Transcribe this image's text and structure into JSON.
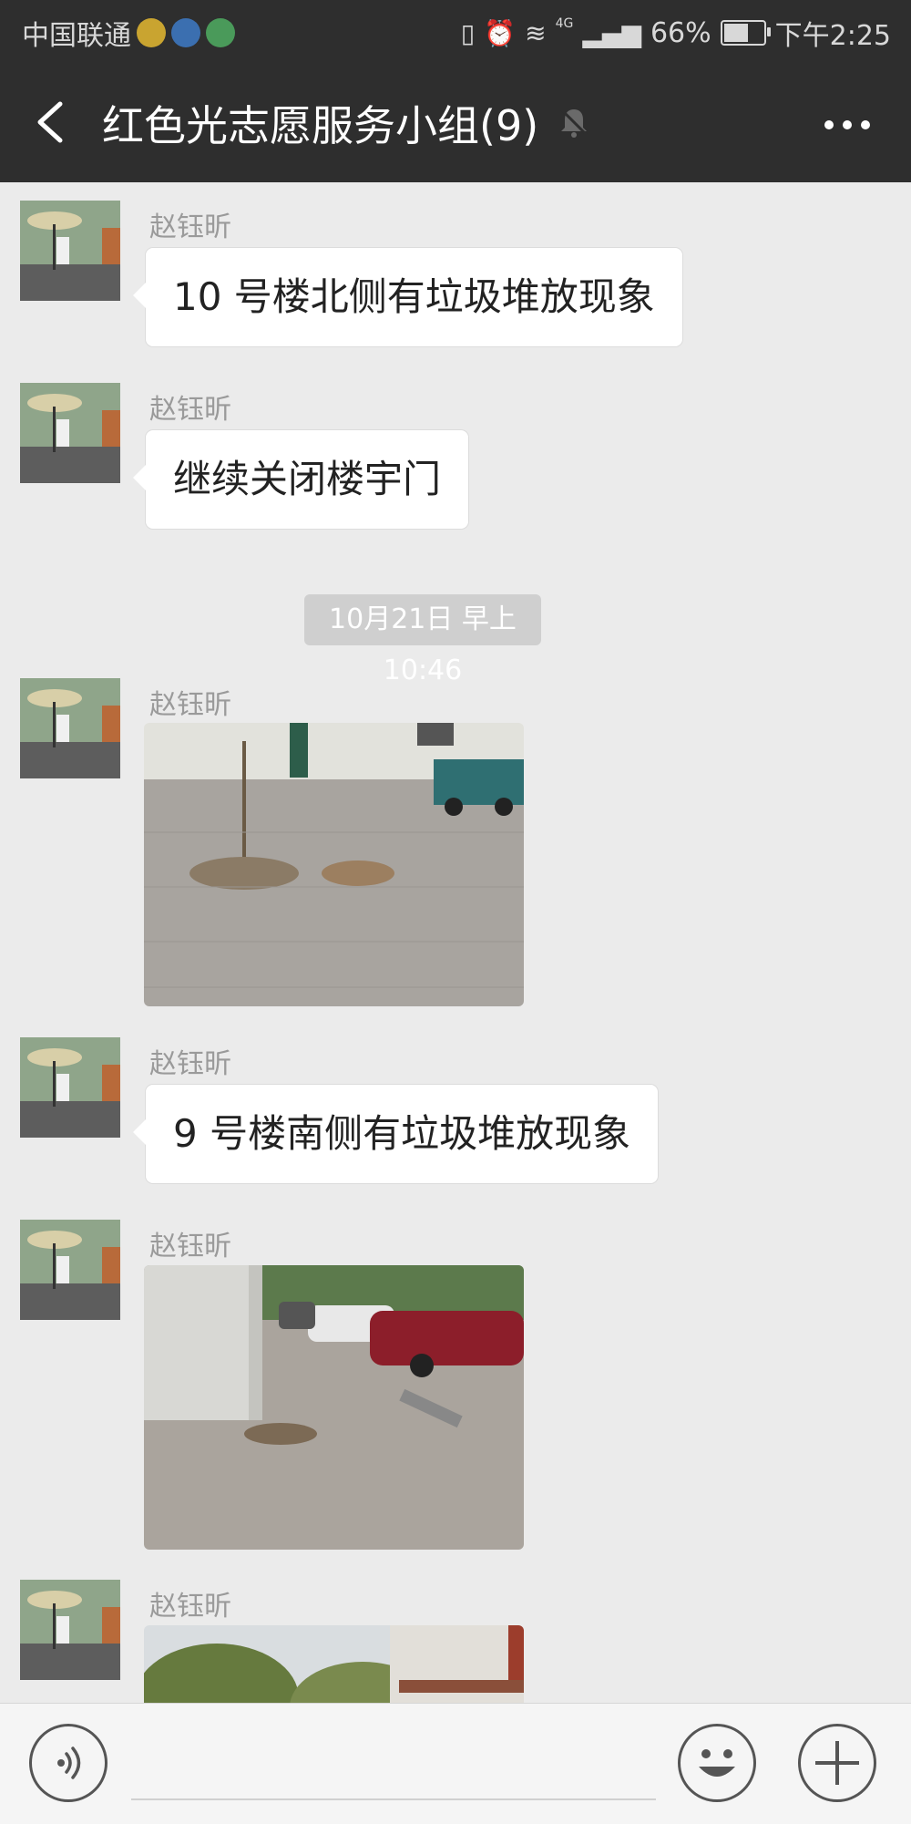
{
  "status_bar": {
    "carrier": "中国联通",
    "network": "4G",
    "battery": "66%",
    "time": "下午2:25"
  },
  "nav": {
    "title": "红色光志愿服务小组(9)"
  },
  "messages": [
    {
      "sender": "赵钰昕",
      "text": "10 号楼北侧有垃圾堆放现象"
    },
    {
      "sender": "赵钰昕",
      "text": "继续关闭楼宇门"
    },
    {
      "timestamp": "10月21日 早上10:46"
    },
    {
      "sender": "赵钰昕",
      "image": "photo-building-rubble"
    },
    {
      "sender": "赵钰昕",
      "text": "9 号楼南侧有垃圾堆放现象"
    },
    {
      "sender": "赵钰昕",
      "image": "photo-parking-rubble"
    },
    {
      "sender": "赵钰昕",
      "image": "photo-trees-building"
    }
  ],
  "colors": {
    "nav_bg": "#2e2e2e",
    "chat_bg": "#ebebeb",
    "bubble_bg": "#ffffff"
  },
  "icons": [
    "back-arrow-icon",
    "mute-bell-icon",
    "more-icon",
    "voice-icon",
    "emoji-icon",
    "plus-icon"
  ]
}
